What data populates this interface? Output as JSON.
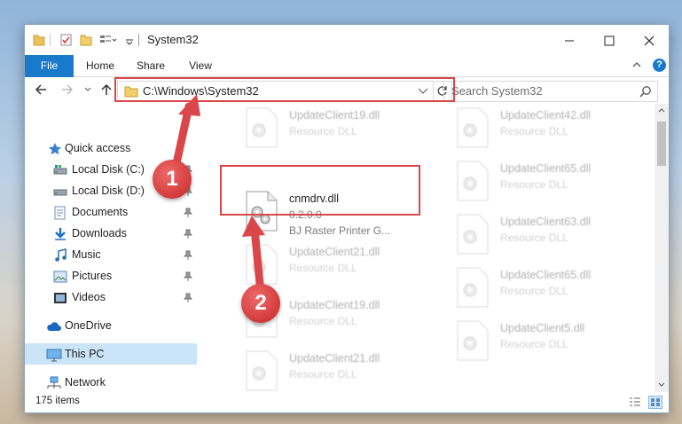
{
  "window": {
    "title": "System32",
    "tabs": [
      "File",
      "Home",
      "Share",
      "View"
    ],
    "help_label": "?"
  },
  "address": {
    "path": "C:\\Windows\\System32",
    "search_placeholder": "Search System32"
  },
  "nav": {
    "items": [
      {
        "label": "Quick access",
        "icon": "star-icon",
        "pinned": false
      },
      {
        "label": "Local Disk (C:)",
        "icon": "drive-icon",
        "pinned": true
      },
      {
        "label": "Local Disk (D:)",
        "icon": "drive-icon",
        "pinned": true
      },
      {
        "label": "Documents",
        "icon": "documents-icon",
        "pinned": true
      },
      {
        "label": "Downloads",
        "icon": "download-icon",
        "pinned": true
      },
      {
        "label": "Music",
        "icon": "music-icon",
        "pinned": true
      },
      {
        "label": "Pictures",
        "icon": "pictures-icon",
        "pinned": true
      },
      {
        "label": "Videos",
        "icon": "videos-icon",
        "pinned": true
      },
      {
        "label": "OneDrive",
        "icon": "cloud-icon",
        "pinned": false
      },
      {
        "label": "This PC",
        "icon": "computer-icon",
        "pinned": false,
        "selected": true
      },
      {
        "label": "Network",
        "icon": "network-icon",
        "pinned": false
      }
    ]
  },
  "files": {
    "highlighted": {
      "name": "cnmdrv.dll",
      "version": "0.2.0.0",
      "description": "BJ Raster Printer G..."
    },
    "background": [
      {
        "name": "UpdateClient19.dll",
        "type": "Resource DLL"
      },
      {
        "name": "UpdateClient42.dll",
        "type": "Resource DLL"
      },
      {
        "name": "UpdateClient65.dll",
        "type": "Resource DLL"
      },
      {
        "name": "UpdateClient21.dll",
        "type": "Resource DLL"
      },
      {
        "name": "UpdateClient63.dll",
        "type": "Resource DLL"
      },
      {
        "name": "UpdateClient19.dll",
        "type": "Resource DLL"
      },
      {
        "name": "UpdateClient65.dll",
        "type": "Resource DLL"
      },
      {
        "name": "UpdateClient21.dll",
        "type": "Resource DLL"
      },
      {
        "name": "UpdateClient5.dll",
        "type": "Resource DLL"
      }
    ]
  },
  "status": {
    "count": "175 items"
  },
  "annotations": {
    "step1": "1",
    "step2": "2"
  },
  "colors": {
    "accent": "#1979ca",
    "highlight": "#d9474a",
    "selection": "#cce4f7"
  }
}
